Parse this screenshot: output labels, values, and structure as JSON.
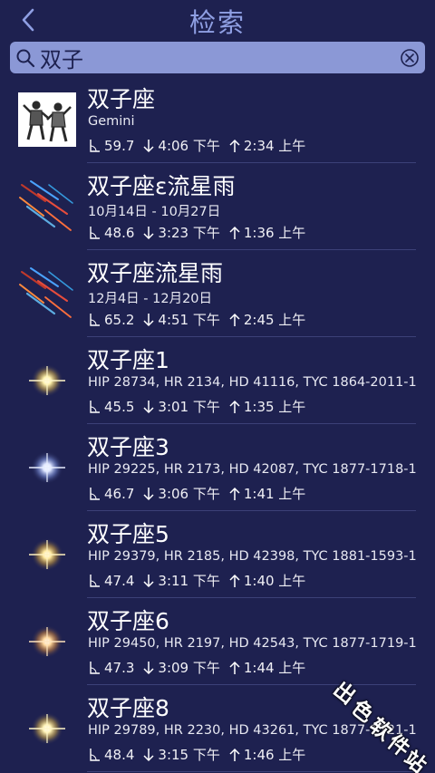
{
  "header": {
    "title": "检索",
    "back_icon": "chevron-left-icon"
  },
  "search": {
    "value": "双子",
    "search_icon": "search-icon",
    "clear_icon": "clear-circle-icon"
  },
  "results": [
    {
      "name": "双子座",
      "subtitle": "Gemini",
      "altitude": "59.7",
      "set": "4:06 下午",
      "rise": "2:34 上午",
      "thumb": "constellation"
    },
    {
      "name": "双子座ε流星雨",
      "subtitle": "10月14日 - 10月27日",
      "altitude": "48.6",
      "set": "3:23 下午",
      "rise": "1:36 上午",
      "thumb": "meteor"
    },
    {
      "name": "双子座流星雨",
      "subtitle": "12月4日 - 12月20日",
      "altitude": "65.2",
      "set": "4:51 下午",
      "rise": "2:45 上午",
      "thumb": "meteor"
    },
    {
      "name": "双子座1",
      "subtitle": "HIP 28734, HR 2134, HD 41116, TYC 1864-2011-1",
      "altitude": "45.5",
      "set": "3:01 下午",
      "rise": "1:35 上午",
      "thumb": "star-yellow"
    },
    {
      "name": "双子座3",
      "subtitle": "HIP 29225, HR 2173, HD 42087, TYC 1877-1718-1",
      "altitude": "46.7",
      "set": "3:06 下午",
      "rise": "1:41 上午",
      "thumb": "star-blue"
    },
    {
      "name": "双子座5",
      "subtitle": "HIP 29379, HR 2185, HD 42398, TYC 1881-1593-1",
      "altitude": "47.4",
      "set": "3:11 下午",
      "rise": "1:40 上午",
      "thumb": "star-yellow"
    },
    {
      "name": "双子座6",
      "subtitle": "HIP 29450, HR 2197, HD 42543, TYC 1877-1719-1",
      "altitude": "47.3",
      "set": "3:09 下午",
      "rise": "1:44 上午",
      "thumb": "star-orange"
    },
    {
      "name": "双子座8",
      "subtitle": "HIP 29789, HR 2230, HD 43261, TYC 1877-1721-1",
      "altitude": "48.4",
      "set": "3:15 下午",
      "rise": "1:46 上午",
      "thumb": "star-yellow"
    }
  ],
  "watermark": {
    "chars": [
      "出",
      "色",
      "软",
      "件",
      "站"
    ]
  },
  "colors": {
    "background": "#1e2150",
    "title": "#8f9fe3",
    "search_bg": "#8b98d6",
    "divider": "#3c4178"
  }
}
